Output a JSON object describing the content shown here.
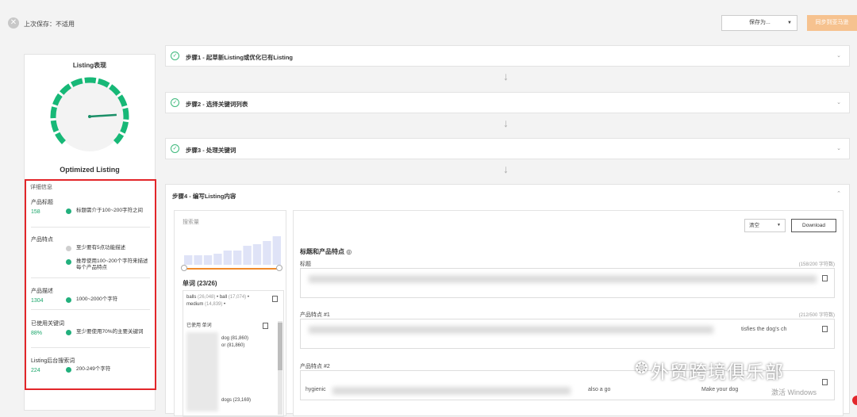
{
  "topbar": {
    "last_save": "上次保存：不适用",
    "save_as_label": "保存为...",
    "sync_button": "同步到亚马逊"
  },
  "left_panel": {
    "title": "Listing表现",
    "status": "Optimized Listing",
    "gauge_level": 0.82,
    "details_heading": "详细信息",
    "sections": [
      {
        "name": "产品标题",
        "value": "158",
        "rules": [
          {
            "status": "pass",
            "text": "标题需介于100~200字符之间"
          }
        ]
      },
      {
        "name": "产品特点",
        "value": "",
        "rules": [
          {
            "status": "pending",
            "text": "至少要有5点功能描述"
          },
          {
            "status": "pass",
            "text": "推荐使用100~200个字符来描述每个产品特点"
          }
        ]
      },
      {
        "name": "产品描述",
        "value": "1304",
        "rules": [
          {
            "status": "pass",
            "text": "1000~2000个字符"
          }
        ]
      },
      {
        "name": "已使用关键词",
        "value": "88%",
        "rules": [
          {
            "status": "pass",
            "text": "至少要使用70%的主要关键词"
          }
        ]
      },
      {
        "name": "Listing后台搜索词",
        "value": "224",
        "rules": [
          {
            "status": "pass",
            "text": "200-249个字符"
          }
        ]
      }
    ]
  },
  "steps": [
    {
      "label": "步骤1 - 起草新Listing或优化已有Listing"
    },
    {
      "label": "步骤2 - 选择关键词列表"
    },
    {
      "label": "步骤3 - 处理关键词"
    }
  ],
  "step4": {
    "label": "步骤4 - 编写Listing内容",
    "keywords": {
      "search_volume_label": "搜索量",
      "histogram": [
        0.3,
        0.3,
        0.3,
        0.35,
        0.45,
        0.45,
        0.6,
        0.65,
        0.75,
        0.9
      ],
      "title": "单词 (23/26)",
      "line1_a": "balls",
      "line1_a_n": "(26,048)",
      "line1_b": "ball",
      "line1_b_n": "(17,074)",
      "line2_a": "medium",
      "line2_a_n": "(14,839)",
      "used_label": "已使用 单词",
      "used_items": [
        "dog (81,860)",
        "or (81,860)",
        "dogs (23,169)"
      ]
    },
    "editor": {
      "clear_select": "清空",
      "download": "Download",
      "title": "标题和产品特点 ◎",
      "title_field_label": "标题",
      "title_count": "(158/200 字符数)",
      "bullet1_label": "产品特点 #1",
      "bullet1_count": "(212/500 字符数)",
      "bullet1_text": "tisfies the dog's ch",
      "bullet2_label": "产品特点 #2",
      "bullet2_text_a": "hygienic",
      "bullet2_text_b": "also a go",
      "bullet2_text_c": "Make your dog"
    }
  },
  "watermark": "外贸跨境俱乐部",
  "windows_text": "激活 Windows"
}
